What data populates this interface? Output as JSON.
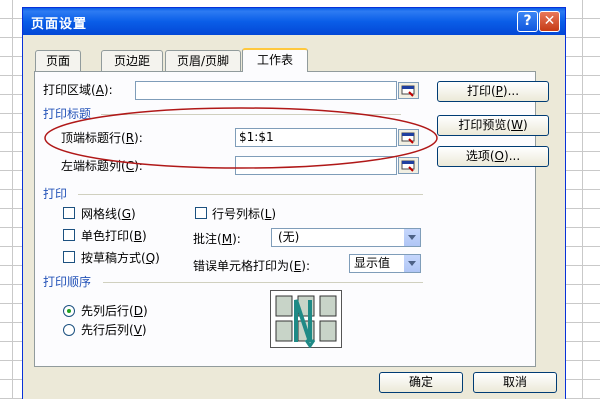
{
  "dialog": {
    "title": "页面设置",
    "help_symbol": "?",
    "close_symbol": "✕"
  },
  "tabs": [
    {
      "label": "页面",
      "active": false
    },
    {
      "label": "页边距",
      "active": false
    },
    {
      "label": "页眉/页脚",
      "active": false
    },
    {
      "label": "工作表",
      "active": true
    }
  ],
  "print_area": {
    "label": "打印区域",
    "key": "A",
    "value": ""
  },
  "print_titles": {
    "section_label": "打印标题",
    "top_rows": {
      "label": "顶端标题行",
      "key": "R",
      "value": "$1:$1"
    },
    "left_cols": {
      "label": "左端标题列",
      "key": "C",
      "value": ""
    }
  },
  "print": {
    "section_label": "打印",
    "gridlines": {
      "label": "网格线",
      "key": "G",
      "checked": false
    },
    "black_white": {
      "label": "单色打印",
      "key": "B",
      "checked": false
    },
    "draft": {
      "label": "按草稿方式",
      "key": "Q",
      "checked": false
    },
    "row_col_headings": {
      "label": "行号列标",
      "key": "L",
      "checked": false
    },
    "comments": {
      "label": "批注",
      "key": "M",
      "value": "(无)"
    },
    "cell_errors": {
      "label": "错误单元格打印为",
      "key": "E",
      "value": "显示值"
    }
  },
  "page_order": {
    "section_label": "打印顺序",
    "down_then_over": {
      "label": "先列后行",
      "key": "D",
      "selected": true
    },
    "over_then_down": {
      "label": "先行后列",
      "key": "V",
      "selected": false
    }
  },
  "buttons": {
    "print": {
      "label": "打印",
      "key": "P",
      "suffix": "..."
    },
    "preview": {
      "label": "打印预览",
      "key": "W"
    },
    "options": {
      "label": "选项",
      "key": "O",
      "suffix": "..."
    },
    "ok": "确定",
    "cancel": "取消"
  },
  "colors": {
    "titlebar": "#0a5ee8",
    "section": "#2453b8",
    "annotation": "#b01818"
  }
}
